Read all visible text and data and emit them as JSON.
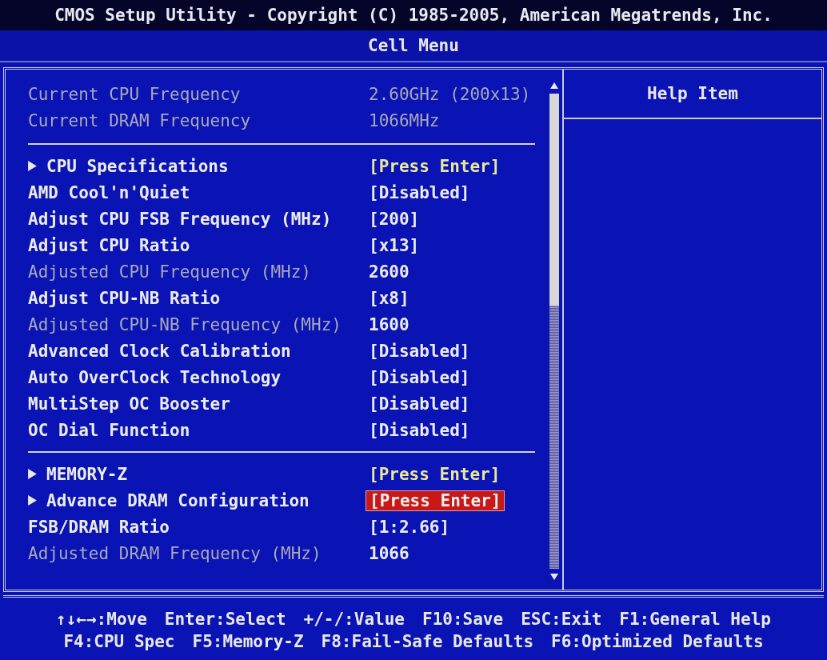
{
  "window": {
    "title": "CMOS Setup Utility - Copyright (C) 1985-2005, American Megatrends, Inc.",
    "subtitle": "Cell Menu"
  },
  "sections": [
    {
      "items": [
        {
          "kind": "info",
          "label": "Current CPU Frequency",
          "value": "2.60GHz (200x13)",
          "selected": false
        },
        {
          "kind": "info",
          "label": "Current DRAM Frequency",
          "value": "1066MHz",
          "selected": false
        }
      ]
    },
    {
      "items": [
        {
          "kind": "submenu",
          "label": "CPU Specifications",
          "value": "[Press Enter]",
          "selected": false
        },
        {
          "kind": "setting",
          "label": "AMD Cool'n'Quiet",
          "value": "[Disabled]",
          "selected": false
        },
        {
          "kind": "setting",
          "label": "Adjust CPU FSB Frequency (MHz)",
          "value": "[200]",
          "selected": false
        },
        {
          "kind": "setting",
          "label": "Adjust CPU Ratio",
          "value": "[x13]",
          "selected": false
        },
        {
          "kind": "readonly",
          "label": "Adjusted CPU Frequency (MHz)",
          "value": "2600",
          "selected": false
        },
        {
          "kind": "setting",
          "label": "Adjust CPU-NB Ratio",
          "value": "[x8]",
          "selected": false
        },
        {
          "kind": "readonly",
          "label": "Adjusted CPU-NB Frequency (MHz)",
          "value": "1600",
          "selected": false
        },
        {
          "kind": "setting",
          "label": "Advanced Clock Calibration",
          "value": "[Disabled]",
          "selected": false
        },
        {
          "kind": "setting",
          "label": "Auto OverClock Technology",
          "value": "[Disabled]",
          "selected": false
        },
        {
          "kind": "setting",
          "label": "MultiStep OC Booster",
          "value": "[Disabled]",
          "selected": false
        },
        {
          "kind": "setting",
          "label": "OC Dial Function",
          "value": "[Disabled]",
          "selected": false
        }
      ]
    },
    {
      "items": [
        {
          "kind": "submenu",
          "label": "MEMORY-Z",
          "value": "[Press Enter]",
          "selected": false
        },
        {
          "kind": "submenu",
          "label": "Advance DRAM Configuration",
          "value": "[Press Enter]",
          "selected": true
        },
        {
          "kind": "setting",
          "label": "FSB/DRAM Ratio",
          "value": "[1:2.66]",
          "selected": false
        },
        {
          "kind": "readonly",
          "label": "Adjusted DRAM Frequency (MHz)",
          "value": "1066",
          "selected": false
        }
      ]
    }
  ],
  "help": {
    "title": "Help Item"
  },
  "footer": [
    [
      "↑↓←→:Move",
      "Enter:Select",
      "+/-/:Value",
      "F10:Save",
      "ESC:Exit",
      "F1:General Help"
    ],
    [
      "F4:CPU Spec",
      "F5:Memory-Z",
      "F8:Fail-Safe Defaults",
      "F6:Optimized Defaults"
    ]
  ]
}
